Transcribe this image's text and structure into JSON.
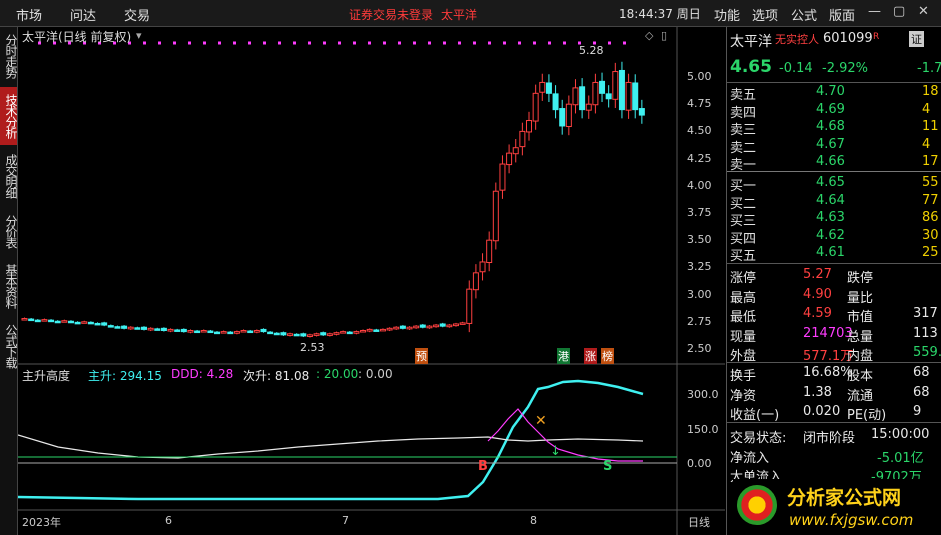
{
  "menu": {
    "items": [
      "市场",
      "问达",
      "交易"
    ],
    "warning": "证券交易未登录",
    "stock_name": "太平洋",
    "clock": "18:44:37 周日",
    "right_items": [
      "功能",
      "选项",
      "公式",
      "版面"
    ]
  },
  "left_tabs": [
    "分时走势",
    "技术分析",
    "成交明细",
    "分价表",
    "基本资料",
    "公式下载"
  ],
  "chart": {
    "title": "太平洋(日线 前复权)",
    "y_ticks": [
      "5.00",
      "4.75",
      "4.50",
      "4.25",
      "4.00",
      "3.75",
      "3.50",
      "3.25",
      "3.00",
      "2.75",
      "2.50"
    ],
    "high_label": "5.28",
    "low_label": "2.53",
    "markers": [
      "预",
      "港",
      "涨",
      "榜"
    ],
    "x_labels": [
      "2023年",
      "6",
      "7",
      "8"
    ],
    "period": "日线",
    "indicator": {
      "name": "主升高度",
      "main_label": "主升: 294.15",
      "ddd_label": "DDD: 4.28",
      "sub_label": "次升: 81.08",
      "twenty_label": ": 20.00",
      "zero_label": ": 0.00",
      "y_ticks": [
        "300.0",
        "150.0",
        "0.00"
      ],
      "signals": [
        "B",
        "S"
      ]
    }
  },
  "chart_data": {
    "type": "candlestick",
    "y_range": [
      2.45,
      5.35
    ],
    "closes": [
      2.78,
      2.77,
      2.76,
      2.77,
      2.76,
      2.75,
      2.76,
      2.75,
      2.74,
      2.75,
      2.74,
      2.73,
      2.72,
      2.71,
      2.7,
      2.69,
      2.7,
      2.69,
      2.68,
      2.69,
      2.68,
      2.67,
      2.68,
      2.67,
      2.66,
      2.67,
      2.66,
      2.67,
      2.66,
      2.65,
      2.66,
      2.65,
      2.66,
      2.67,
      2.66,
      2.67,
      2.66,
      2.65,
      2.64,
      2.63,
      2.64,
      2.63,
      2.62,
      2.63,
      2.64,
      2.63,
      2.64,
      2.65,
      2.66,
      2.65,
      2.66,
      2.67,
      2.68,
      2.67,
      2.68,
      2.69,
      2.7,
      2.69,
      2.7,
      2.71,
      2.7,
      2.71,
      2.72,
      2.71,
      2.72,
      2.73,
      2.74,
      3.05,
      3.2,
      3.3,
      3.5,
      3.95,
      4.2,
      4.3,
      4.35,
      4.5,
      4.6,
      4.85,
      4.95,
      4.85,
      4.7,
      4.55,
      4.75,
      4.9,
      4.7,
      4.75,
      4.95,
      4.85,
      4.8,
      5.05,
      4.7,
      4.95,
      4.7,
      4.65
    ]
  },
  "quote": {
    "name": "太平洋",
    "tag": "无实控人",
    "code": "601099",
    "r_badge": "R",
    "price": "4.65",
    "change": "-0.14",
    "pct": "-2.92%",
    "right_pct": "-1.7",
    "sell_labels": [
      "卖五",
      "卖四",
      "卖三",
      "卖二",
      "卖一"
    ],
    "sell_prices": [
      "4.70",
      "4.69",
      "4.68",
      "4.67",
      "4.66"
    ],
    "sell_vols": [
      "18",
      "4",
      "11",
      "4",
      "17"
    ],
    "buy_labels": [
      "买一",
      "买二",
      "买三",
      "买四",
      "买五"
    ],
    "buy_prices": [
      "4.65",
      "4.64",
      "4.63",
      "4.62",
      "4.61"
    ],
    "buy_vols": [
      "55",
      "77",
      "86",
      "30",
      "25"
    ],
    "stats": [
      {
        "l1": "涨停",
        "v1": "5.27",
        "l2": "跌停",
        "v2": ""
      },
      {
        "l1": "最高",
        "v1": "4.90",
        "l2": "量比",
        "v2": ""
      },
      {
        "l1": "最低",
        "v1": "4.59",
        "l2": "市值",
        "v2": "317"
      },
      {
        "l1": "现量",
        "v1": "214703",
        "l2": "总量",
        "v2": "113"
      },
      {
        "l1": "外盘",
        "v1": "577.1万",
        "l2": "内盘",
        "v2": "559."
      }
    ],
    "stats2": [
      {
        "l1": "换手",
        "v1": "16.68%",
        "l2": "股本",
        "v2": "68"
      },
      {
        "l1": "净资",
        "v1": "1.38",
        "l2": "流通",
        "v2": "68"
      },
      {
        "l1": "收益(一)",
        "v1": "0.020",
        "l2": "PE(动)",
        "v2": "9"
      }
    ],
    "status_label": "交易状态:",
    "status_value": "闭市阶段",
    "status_time": "15:00:00",
    "netflow_label": "净流入",
    "netflow_value": "-5.01亿",
    "bigflow_label": "大单流入",
    "bigflow_value": "-9702万"
  },
  "watermark": {
    "brand": "分析家公式网",
    "url": "www.fxjgsw.com"
  },
  "colors": {
    "up": "#ff4040",
    "down": "#2bd66a",
    "cyan": "#3ff0f0",
    "magenta": "#ff3cff"
  }
}
